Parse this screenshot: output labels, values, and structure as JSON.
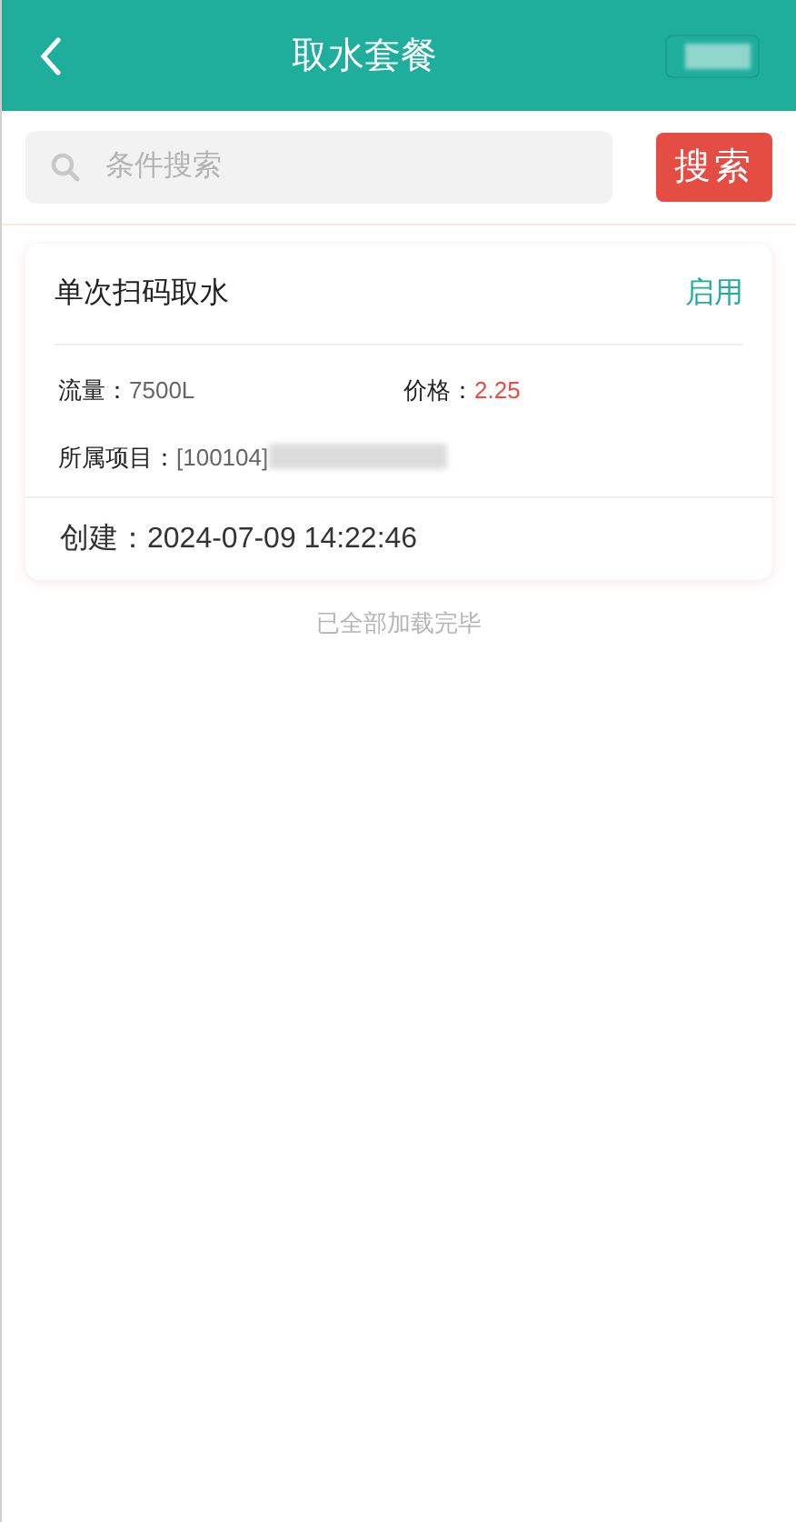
{
  "header": {
    "title": "取水套餐"
  },
  "search": {
    "placeholder": "条件搜索",
    "button": "搜索"
  },
  "packages": [
    {
      "name": "单次扫码取水",
      "status": "启用",
      "flow_label": "流量：",
      "flow": "7500L",
      "price_label": "价格：",
      "price": "2.25",
      "project_label": "所属项目：",
      "project": "[100104]",
      "created_label": "创建：",
      "created": "2024-07-09 14:22:46"
    }
  ],
  "footer": "已全部加载完毕"
}
